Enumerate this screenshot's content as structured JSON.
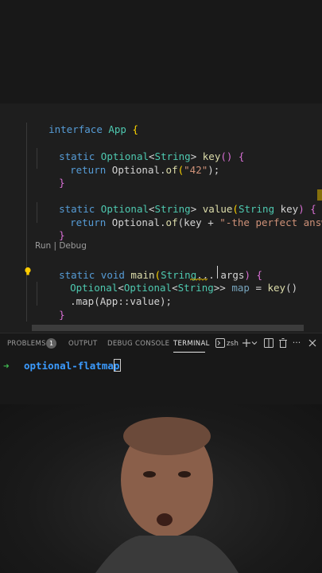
{
  "editor": {
    "lines": {
      "l1": {
        "kw": "interface ",
        "name": "App",
        "brace": " {"
      },
      "l2": {
        "kw": "static ",
        "type": "Optional",
        "lt": "<",
        "targ": "String",
        "gt": "> ",
        "fn": "key",
        "rest": "() {"
      },
      "l3": {
        "kw": "return ",
        "type": "Optional",
        "dot": ".",
        "fn": "of",
        "open": "(",
        "str": "\"42\"",
        "close": ");"
      },
      "l4": {
        "brace": "}"
      },
      "l5": {
        "kw": "static ",
        "type": "Optional",
        "lt": "<",
        "targ": "String",
        "gt": "> ",
        "fn": "value",
        "open": "(",
        "ptype": "String",
        "pname": " key",
        "close": ") {"
      },
      "l6": {
        "kw": "return ",
        "type": "Optional",
        "dot": ".",
        "fn": "of",
        "open": "(key + ",
        "str": "\"-the perfect answer\"",
        "close": ");"
      },
      "l7": {
        "brace": "}"
      },
      "l8": {
        "kw": "static void ",
        "fn": "main",
        "open": "(",
        "ptype": "String",
        "pname": "... args",
        "close": ") {"
      },
      "l9": {
        "type": "Optional",
        "lt": "<",
        "targ": "Optional",
        "lt2": "<",
        "targ2": "String",
        "gt": ">> ",
        "var": "map",
        "eq": " = ",
        "fn": "key",
        "close": "()"
      },
      "l10": {
        "text": ".map(App::value);"
      },
      "l11": {
        "brace": "}"
      },
      "l12": {
        "brace": "}"
      }
    },
    "codelens": "Run | Debug"
  },
  "panel": {
    "tabs": {
      "problems": "PROBLEMS",
      "problems_count": "1",
      "output": "OUTPUT",
      "debug_console": "DEBUG CONSOLE",
      "terminal": "TERMINAL"
    },
    "shell": "zsh"
  },
  "terminal": {
    "arrow": "➜",
    "dir": "optional-flatmap"
  },
  "colors": {
    "keyword": "#569cd6",
    "type": "#4ec9b0",
    "function": "#dcdcaa",
    "string": "#ce9178",
    "prompt_arrow": "#3fb950",
    "prompt_dir": "#3b9bff"
  },
  "icons": [
    "lightbulb-icon",
    "terminal-icon",
    "plus-icon",
    "chevron-down-icon",
    "split-icon",
    "trash-icon",
    "ellipsis-icon",
    "close-icon"
  ]
}
